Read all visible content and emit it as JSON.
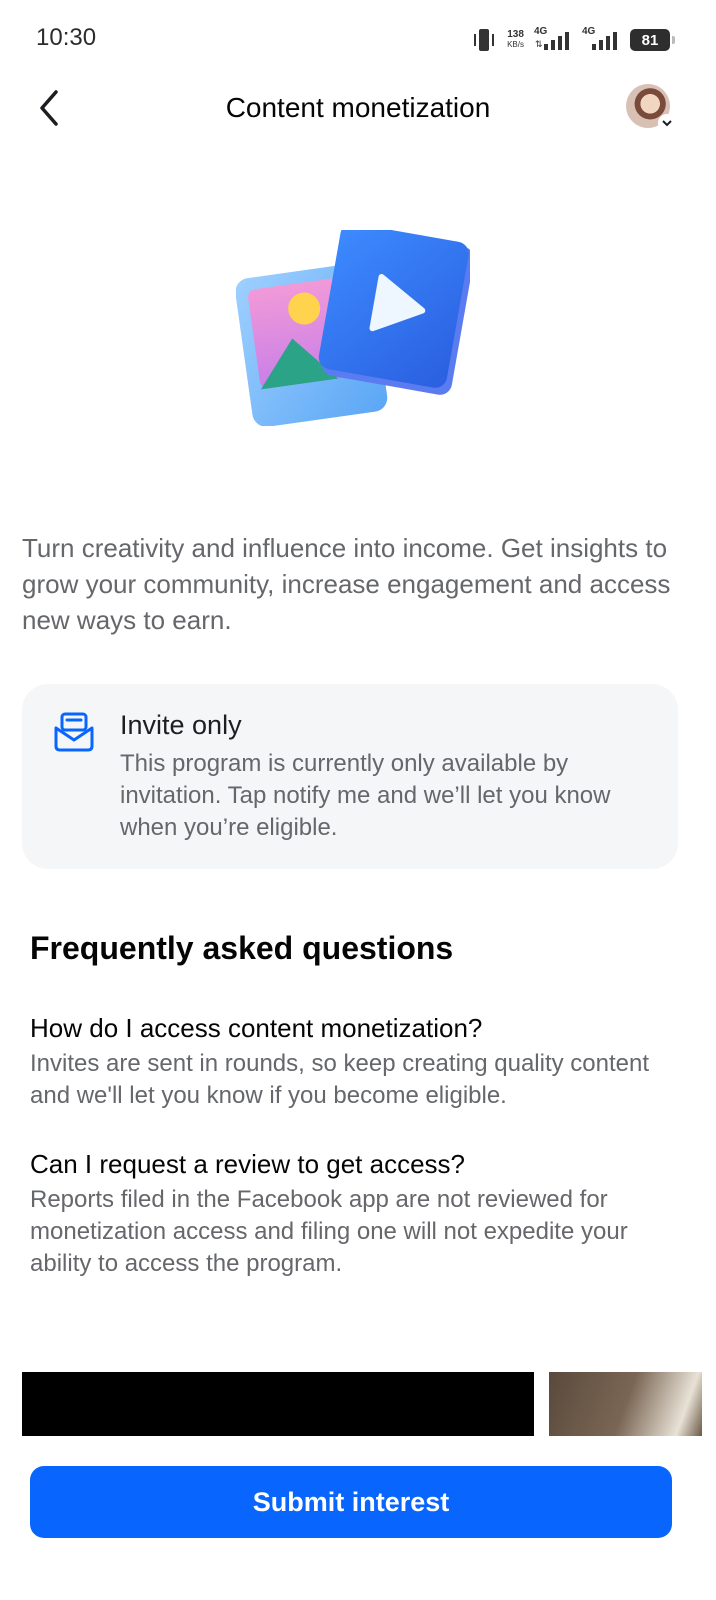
{
  "status_bar": {
    "time": "10:30",
    "speed_value": "138",
    "speed_unit": "KB/s",
    "network_1": "4G",
    "network_2": "4G",
    "battery": "81"
  },
  "header": {
    "title": "Content monetization",
    "back_icon": "chevron-left-icon",
    "avatar_icon": "profile-avatar"
  },
  "intro": "Turn creativity and influence into income. Get insights to grow your community, increase engagement and access new ways to earn.",
  "invite_card": {
    "icon": "mail-inbox-icon",
    "title": "Invite only",
    "body": "This program is currently only available by invitation. Tap notify me and we’ll let you know when you’re eligible."
  },
  "faq": {
    "heading": "Frequently asked questions",
    "items": [
      {
        "question": "How do I access content monetization?",
        "answer": "Invites are sent in rounds, so keep creating quality content and we'll let you know if you become eligible."
      },
      {
        "question": "Can I request a review to get access?",
        "answer": "Reports filed in the Facebook app are not reviewed for monetization access and filing one will not expedite your ability to access the program."
      }
    ]
  },
  "footer": {
    "submit_label": "Submit interest"
  },
  "colors": {
    "accent": "#0866ff",
    "secondary_text": "#65676b",
    "card_bg": "#f5f6f8"
  }
}
